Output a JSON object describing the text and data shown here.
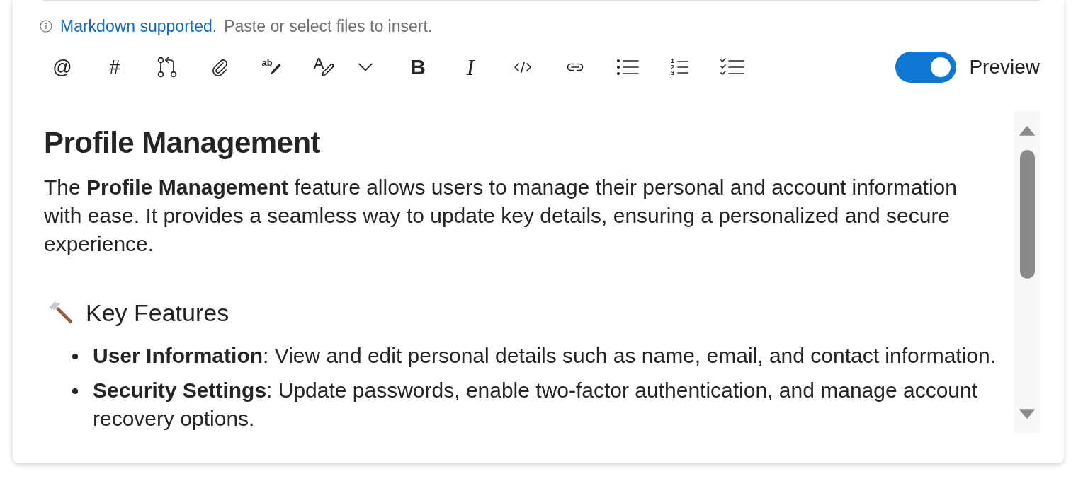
{
  "hint": {
    "link": "Markdown supported.",
    "text": "Paste or select files to insert."
  },
  "toolbar": [
    {
      "kind": "mention",
      "glyph": "@"
    },
    {
      "kind": "hashtag",
      "glyph": "#"
    },
    {
      "kind": "pullrequest"
    },
    {
      "kind": "attach"
    },
    {
      "kind": "spellcheck",
      "glyph": "ab"
    },
    {
      "kind": "format",
      "glyph": "A"
    },
    {
      "kind": "dropdown"
    },
    {
      "kind": "bold",
      "glyph": "B"
    },
    {
      "kind": "italic",
      "glyph": "I"
    },
    {
      "kind": "code"
    },
    {
      "kind": "link"
    },
    {
      "kind": "bullets"
    },
    {
      "kind": "numbered",
      "glyph": "123"
    },
    {
      "kind": "checklist"
    }
  ],
  "preview_toggle": {
    "label": "Preview",
    "on": true
  },
  "document": {
    "heading": "Profile Management",
    "paragraph": "The **Profile Management** feature allows users to manage their personal and account information with ease. It provides a seamless way to update key details, ensuring a personalized and secure experience.",
    "section": {
      "title": "Key Features",
      "items": [
        "**User Information**: View and edit personal details such as name, email, and contact information.",
        "**Security Settings**: Update passwords, enable two-factor authentication, and manage account recovery options."
      ]
    }
  }
}
